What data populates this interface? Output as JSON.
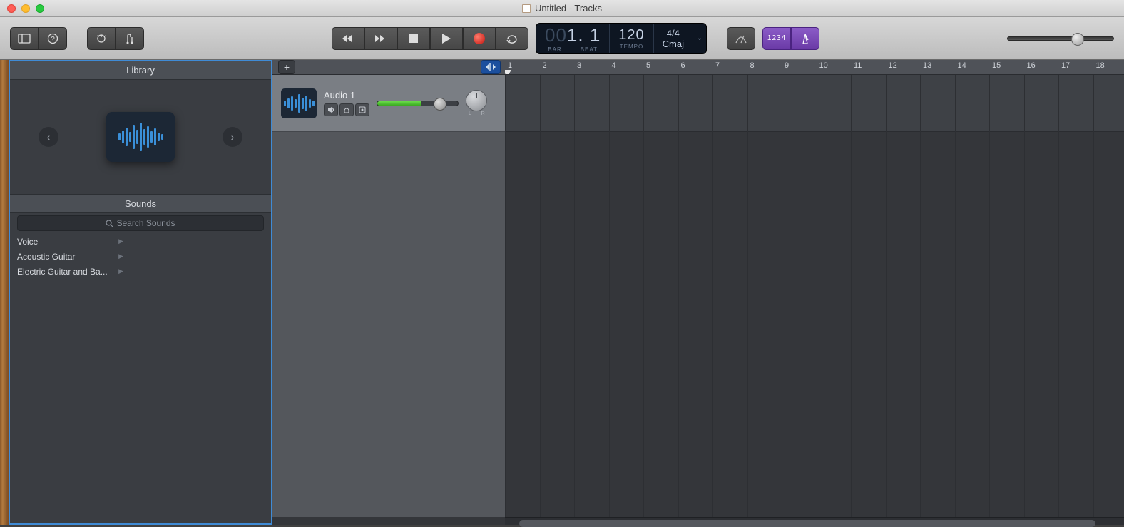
{
  "window": {
    "title": "Untitled - Tracks"
  },
  "lcd": {
    "bar_dim": "00",
    "bar": "1. 1",
    "bar_label": "BAR",
    "beat_label": "BEAT",
    "tempo": "120",
    "tempo_label": "TEMPO",
    "timesig": "4/4",
    "key": "Cmaj"
  },
  "toolbar": {
    "count_in": "1234"
  },
  "library": {
    "title": "Library",
    "sounds_title": "Sounds",
    "search_placeholder": "Search Sounds",
    "categories": [
      {
        "label": "Voice"
      },
      {
        "label": "Acoustic Guitar"
      },
      {
        "label": "Electric Guitar and Ba..."
      }
    ]
  },
  "ruler": {
    "start": 1,
    "end": 18
  },
  "tracks": [
    {
      "name": "Audio 1",
      "pan_label": "L   R"
    }
  ]
}
